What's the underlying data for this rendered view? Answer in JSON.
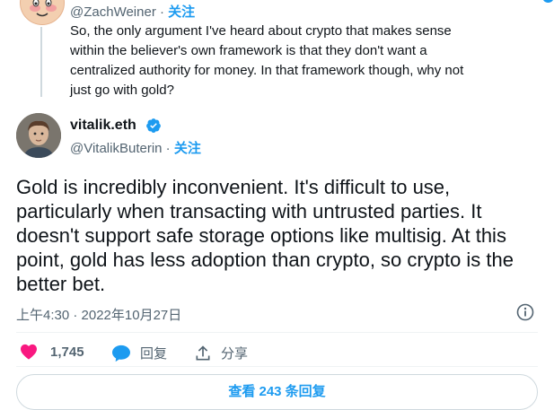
{
  "quoted": {
    "handle": "@ZachWeiner",
    "separator": "·",
    "follow": "关注",
    "lines": [
      "So, the only argument I've heard about crypto that makes sense",
      "within the believer's own framework is that they don't want a",
      "centralized authority for money. In that framework though, why not",
      "just go with gold?"
    ]
  },
  "author": {
    "name": "vitalik.eth",
    "handle": "@VitalikButerin",
    "separator": "·",
    "follow": "关注"
  },
  "tweet": {
    "lines": [
      "Gold is incredibly inconvenient. It's difficult to use,",
      "particularly when transacting with untrusted parties. It",
      "doesn't support safe storage options like multisig. At this",
      "point, gold has less adoption than crypto, so crypto is the",
      "better bet."
    ],
    "timestamp": "上午4:30 · 2022年10月27日"
  },
  "actions": {
    "like_count": "1,745",
    "reply_label": "回复",
    "share_label": "分享"
  },
  "replies": {
    "label": "查看 243 条回复"
  },
  "colors": {
    "accent": "#1d9bf0",
    "like": "#f91880",
    "secondary_text": "#536471"
  }
}
